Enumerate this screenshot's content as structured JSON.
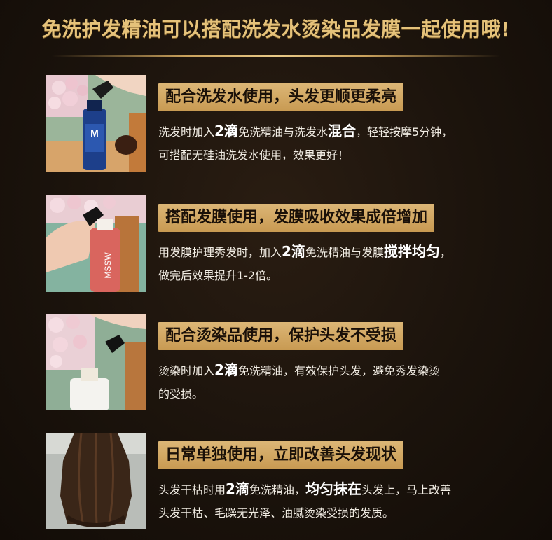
{
  "title": "免洗护发精油可以搭配洗发水烫染品发膜一起使用哦!",
  "sections": [
    {
      "heading": "配合洗发水使用，头发更顺更柔亮",
      "line1": [
        "洗发时加入",
        "2滴",
        "免洗精油与洗发水",
        "混合",
        "，轻轻按摩5分钟，"
      ],
      "line2": [
        "可搭配无硅油洗发水使用，效果更好！"
      ],
      "photo": "hand-dropping-oil-into-blue-shampoo-bottle",
      "bottle_label": "M"
    },
    {
      "heading": "搭配发膜使用，发膜吸收效果成倍增加",
      "line1": [
        "用发膜护理秀发时，加入",
        "2滴",
        "免洗精油与发膜",
        "搅拌均匀",
        "，"
      ],
      "line2": [
        "做完后效果提升1-2倍。"
      ],
      "photo": "hand-dropping-oil-into-pink-hair-mask-bottle",
      "bottle_label": "MSSW"
    },
    {
      "heading": "配合烫染品使用，保护头发不受损",
      "line1": [
        "烫染时加入",
        "2滴",
        "免洗精油，有效保护头发，避免秀发染烫"
      ],
      "line2": [
        "的受损。"
      ],
      "photo": "hand-dropping-oil-into-white-dye-bottle"
    },
    {
      "heading": "日常单独使用，立即改善头发现状",
      "line1": [
        "头发干枯时用",
        "2滴",
        "免洗精油，",
        "均匀抹在",
        "头发上，马上改善"
      ],
      "line2": [
        "头发干枯、毛躁无光泽、油腻烫染受损的发质。"
      ],
      "photo": "back-view-of-long-dark-hair"
    }
  ]
}
